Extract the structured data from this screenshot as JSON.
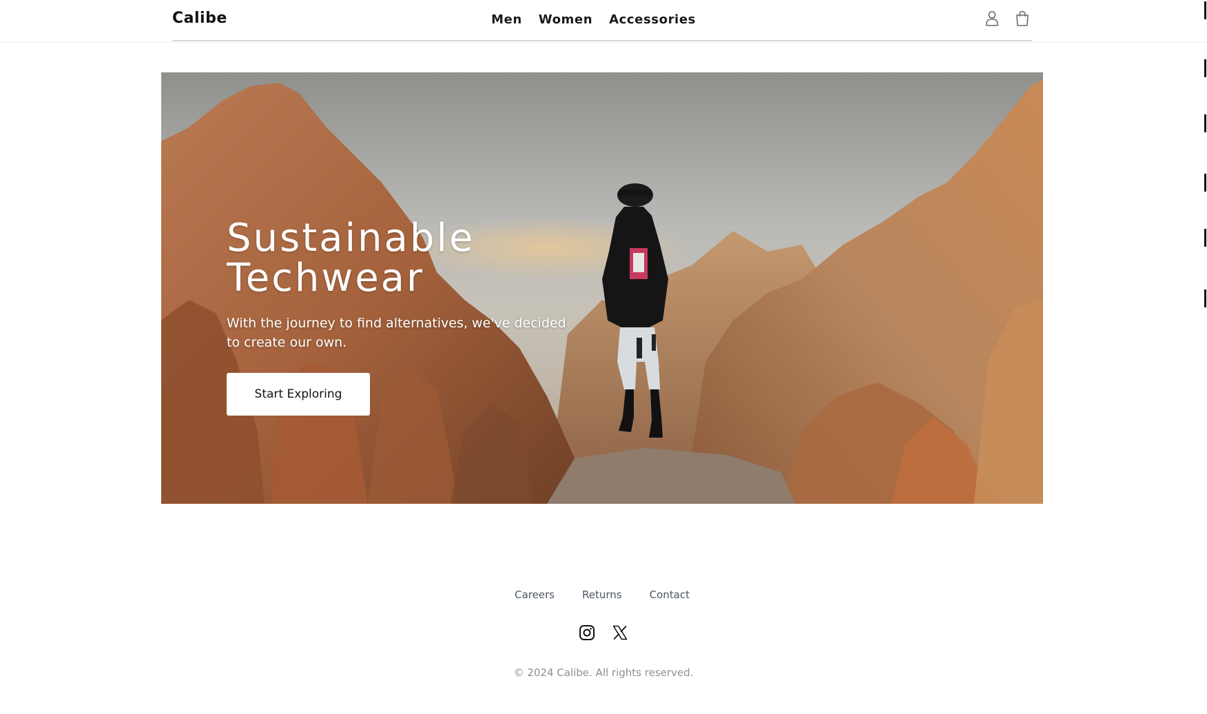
{
  "header": {
    "logo": "Calibe",
    "nav": [
      "Men",
      "Women",
      "Accessories"
    ],
    "icons": [
      "user-icon",
      "shopping-bag-icon"
    ]
  },
  "hero": {
    "title_line1": "Sustainable",
    "title_line2": "Techwear",
    "subtitle": "With the journey to find alternatives, we've decided to create our own.",
    "cta_label": "Start Exploring"
  },
  "footer": {
    "links": [
      "Careers",
      "Returns",
      "Contact"
    ],
    "social": [
      "instagram-icon",
      "x-icon"
    ],
    "copyright": "© 2024 Calibe. All rights reserved."
  },
  "colors": {
    "text": "#111111",
    "footer_link": "#4b5563",
    "copyright": "#8a8f98",
    "button_bg": "#ffffff"
  }
}
